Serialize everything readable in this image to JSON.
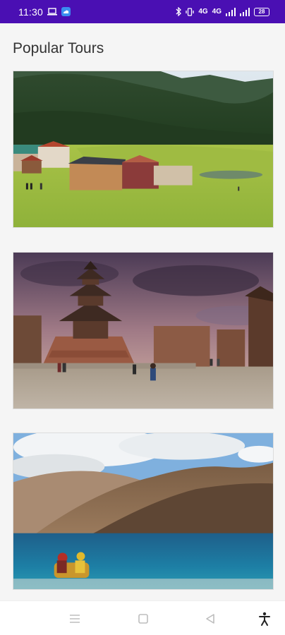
{
  "status_bar": {
    "time": "11:30",
    "left_icons": [
      "laptop-icon",
      "cloud-app-icon"
    ],
    "right_icons": [
      "bluetooth-icon",
      "vibrate-icon",
      "volte-icon",
      "volte2-icon",
      "signal-icon",
      "signal2-icon"
    ],
    "network_label_1": "4G",
    "network_label_2": "4G",
    "battery": "28",
    "bg_color": "#4a0fb3"
  },
  "page": {
    "title": "Popular Tours"
  },
  "tours": [
    {
      "image": "mountain-valley-village-photo"
    },
    {
      "image": "pagoda-temple-square-photo"
    },
    {
      "image": "mountain-lake-photo"
    }
  ],
  "nav_bar": {
    "icons": [
      "menu-icon",
      "home-square-icon",
      "back-triangle-icon",
      "accessibility-icon"
    ]
  }
}
